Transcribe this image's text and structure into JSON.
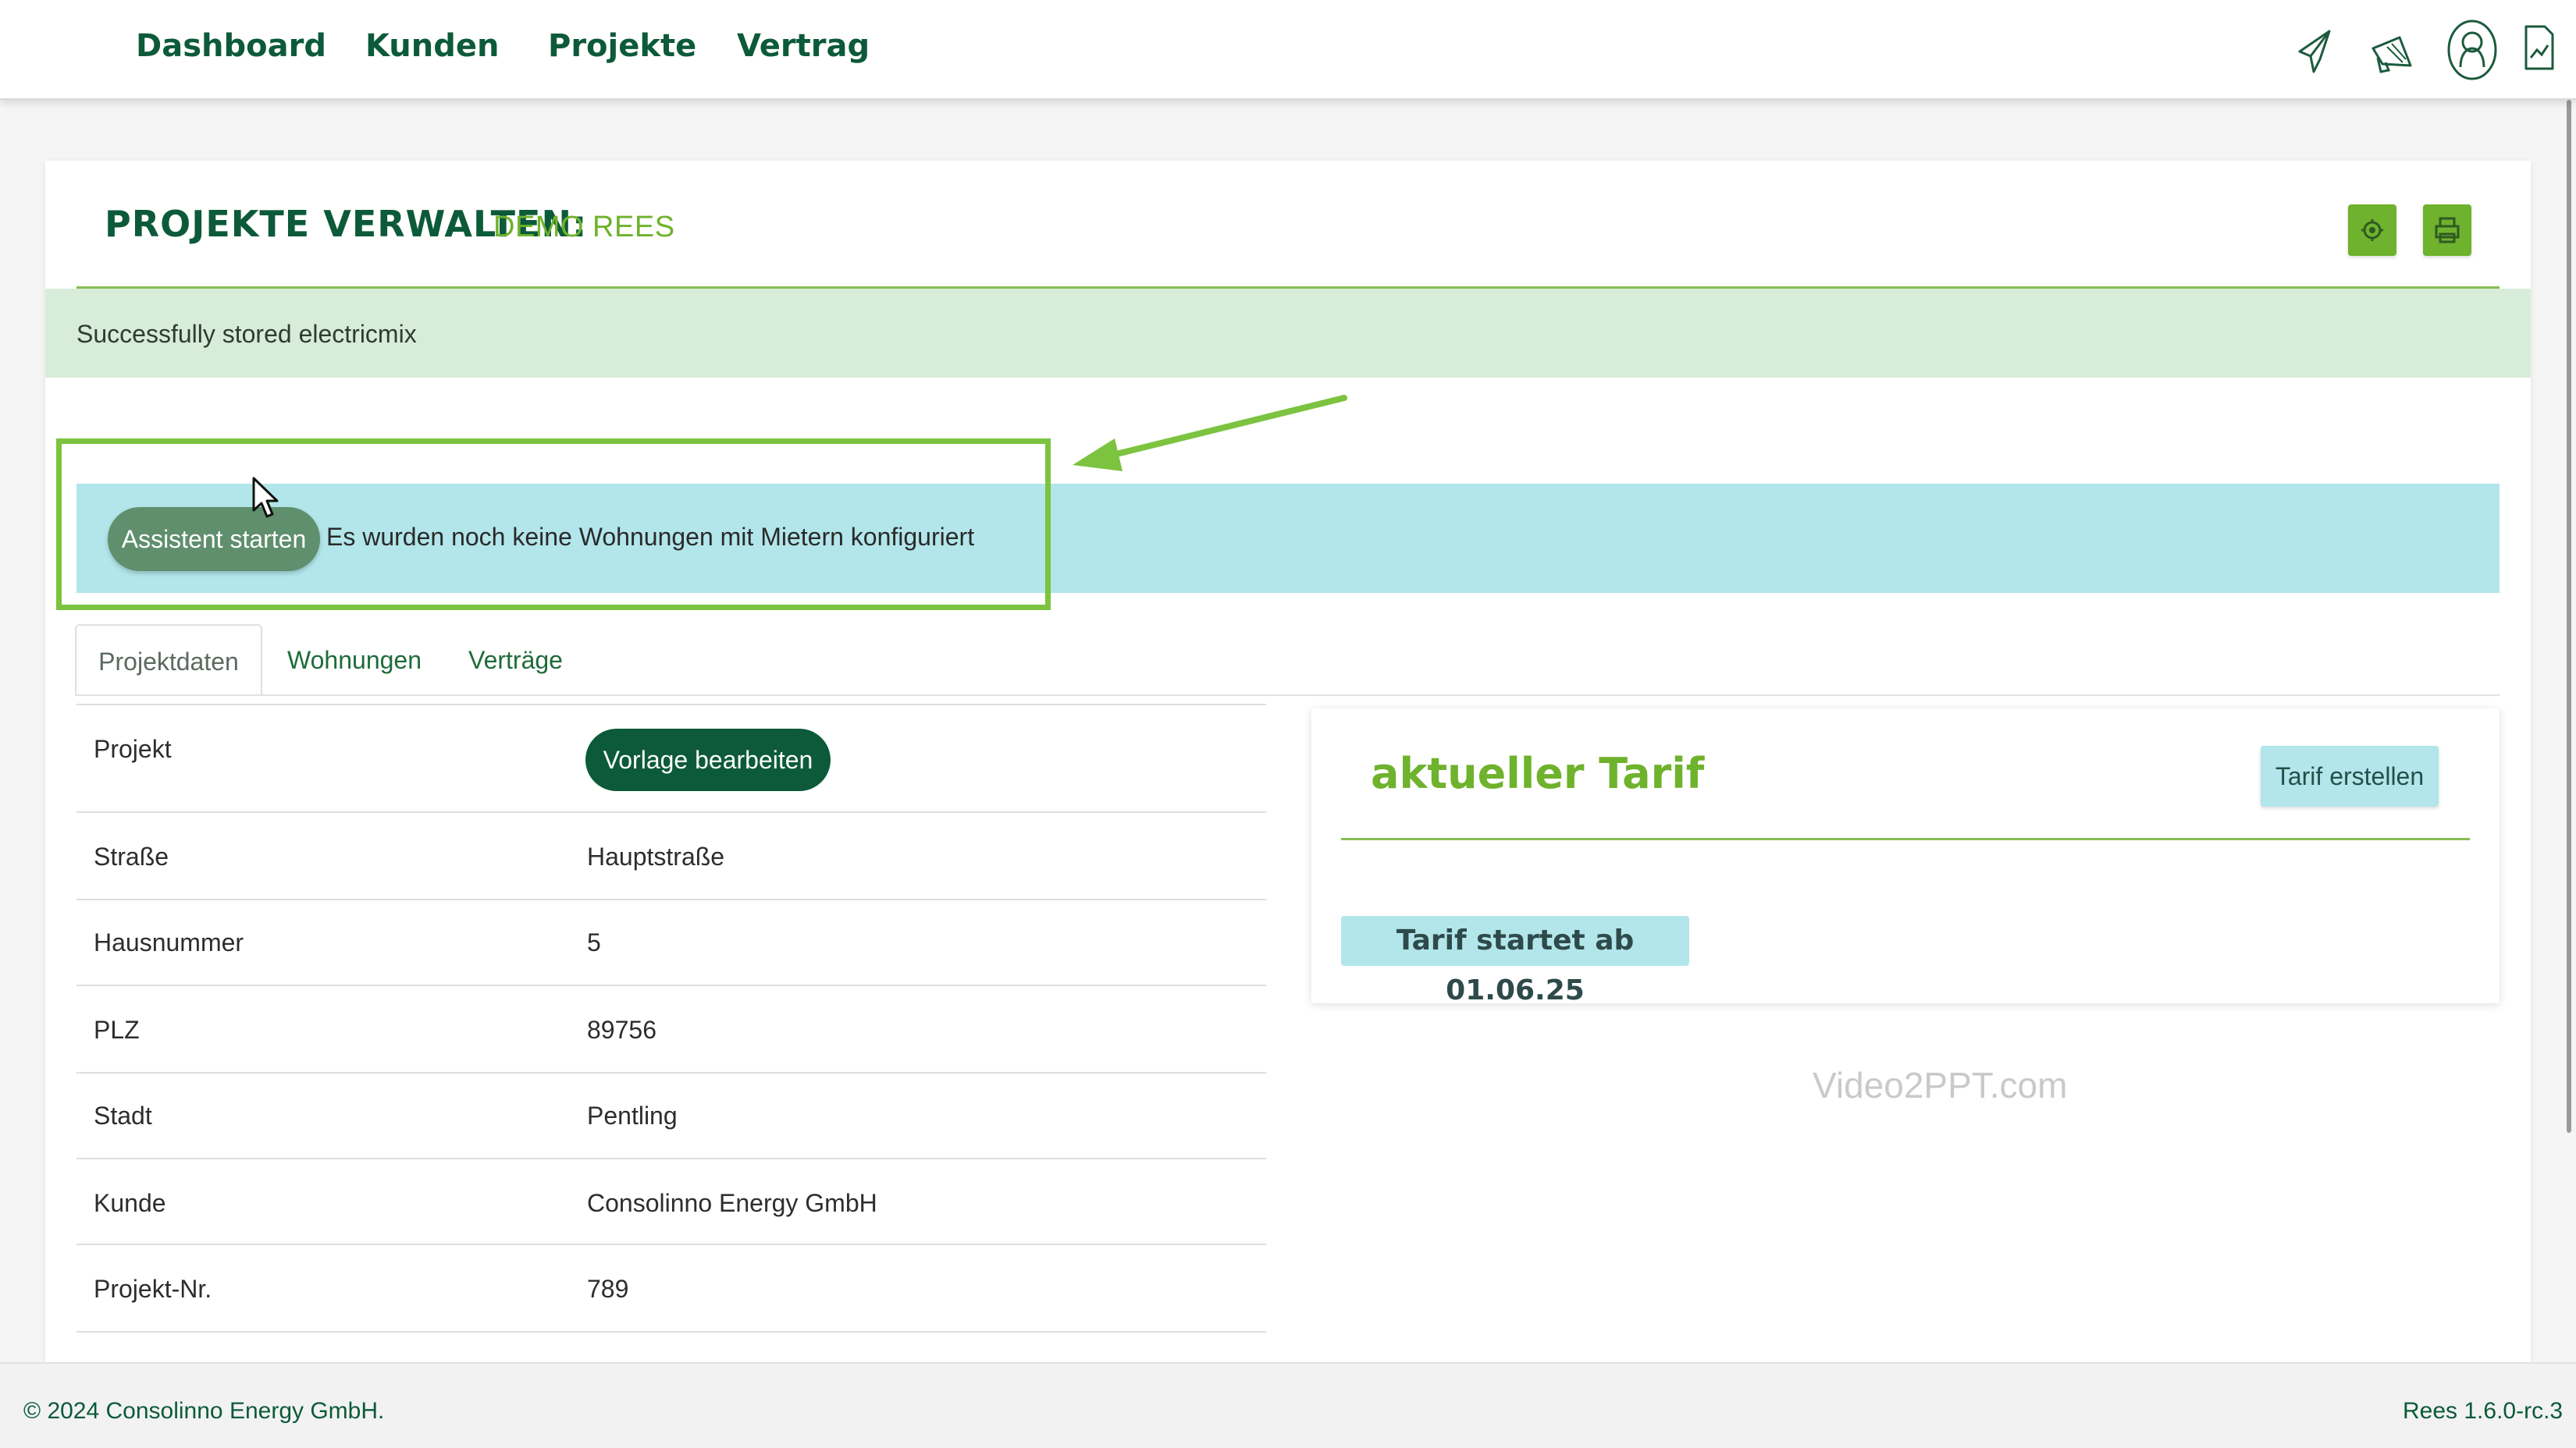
{
  "nav": {
    "items": [
      {
        "label": "Dashboard"
      },
      {
        "label": "Kunden"
      },
      {
        "label": "Projekte"
      },
      {
        "label": "Vertrag"
      }
    ],
    "icons": [
      "paper-plane-icon",
      "megaphone-icon",
      "user-profile-icon",
      "document-icon"
    ]
  },
  "page": {
    "title": "PROJEKTE VERWALTEN:",
    "subtitle": "DEMO REES",
    "header_buttons": [
      "settings-icon",
      "print-icon"
    ]
  },
  "alert": {
    "message": "Successfully stored electricmix"
  },
  "banner": {
    "button_label": "Assistent starten",
    "message": "Es wurden noch keine Wohnungen mit Mietern konfiguriert"
  },
  "tabs": [
    {
      "label": "Projektdaten",
      "active": true
    },
    {
      "label": "Wohnungen",
      "active": false
    },
    {
      "label": "Verträge",
      "active": false
    }
  ],
  "project": {
    "template_button_label": "Vorlage bearbeiten",
    "rows": [
      {
        "label": "Projekt",
        "value": ""
      },
      {
        "label": "Straße",
        "value": "Hauptstraße"
      },
      {
        "label": "Hausnummer",
        "value": "5"
      },
      {
        "label": "PLZ",
        "value": "89756"
      },
      {
        "label": "Stadt",
        "value": "Pentling"
      },
      {
        "label": "Kunde",
        "value": "Consolinno Energy GmbH"
      },
      {
        "label": "Projekt-Nr.",
        "value": "789"
      }
    ]
  },
  "tarif": {
    "title": "aktueller Tarif",
    "create_button_label": "Tarif erstellen",
    "start_text": "Tarif startet ab 01.06.25"
  },
  "watermark": "Video2PPT.com",
  "footer": {
    "copyright": "© 2024 Consolinno Energy GmbH.",
    "version": "Rees 1.6.0-rc.3"
  },
  "colors": {
    "brand_dark_green": "#0c5a3a",
    "brand_light_green": "#6fb22d",
    "info_cyan": "#b2e6ea",
    "success_bg": "#d7ecd9",
    "highlight": "#7cc33f"
  }
}
